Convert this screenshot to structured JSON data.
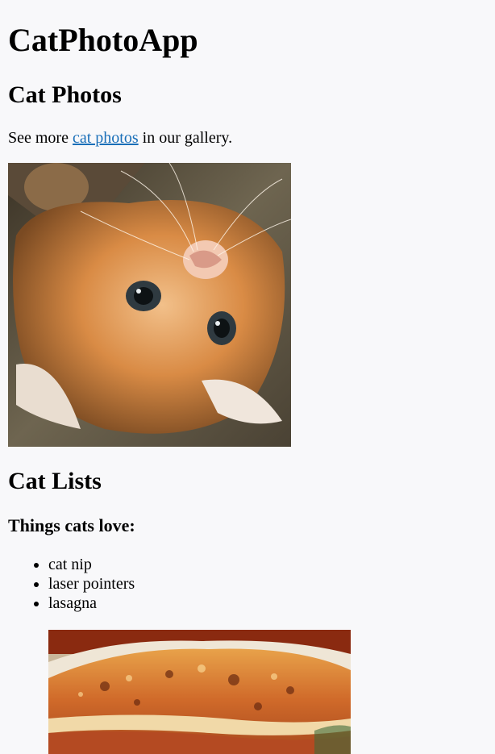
{
  "header": {
    "app_title": "CatPhotoApp"
  },
  "photos_section": {
    "heading": "Cat Photos",
    "text_before": "See more ",
    "link_text": "cat photos",
    "text_after": " in our gallery.",
    "image_alt": "A cute orange cat lying on its back."
  },
  "lists_section": {
    "heading": "Cat Lists",
    "subheading": "Things cats love:",
    "items": [
      "cat nip",
      "laser pointers",
      "lasagna"
    ],
    "image_alt": "A slice of lasagna on a plate."
  },
  "colors": {
    "background": "#f8f8fa",
    "link": "#1a6fb8"
  }
}
